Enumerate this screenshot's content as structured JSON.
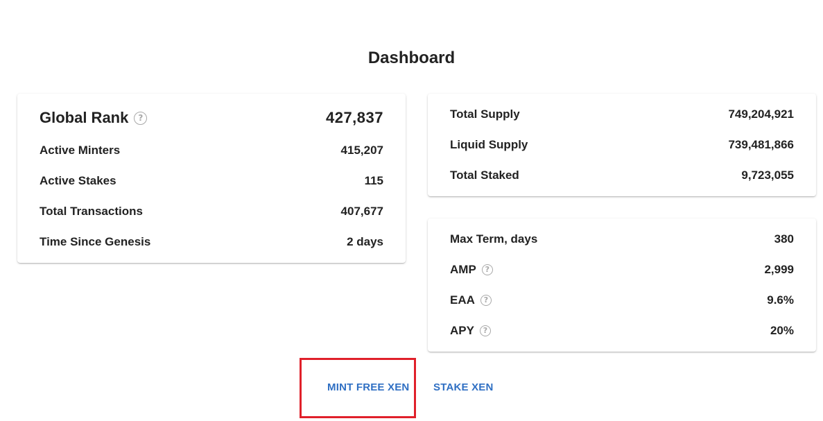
{
  "page": {
    "title": "Dashboard"
  },
  "stats_card": {
    "global_rank": {
      "label": "Global Rank",
      "value": "427,837",
      "icon": "help-circle-icon"
    },
    "rows": [
      {
        "label": "Active Minters",
        "value": "415,207"
      },
      {
        "label": "Active Stakes",
        "value": "115"
      },
      {
        "label": "Total Transactions",
        "value": "407,677"
      },
      {
        "label": "Time Since Genesis",
        "value": "2 days"
      }
    ]
  },
  "supply_card": {
    "rows": [
      {
        "label": "Total Supply",
        "value": "749,204,921"
      },
      {
        "label": "Liquid Supply",
        "value": "739,481,866"
      },
      {
        "label": "Total Staked",
        "value": "9,723,055"
      }
    ]
  },
  "params_card": {
    "rows": [
      {
        "label": "Max Term, days",
        "value": "380"
      },
      {
        "label": "AMP",
        "value": "2,999",
        "icon": "help-circle-icon"
      },
      {
        "label": "EAA",
        "value": "9.6%",
        "icon": "help-circle-icon"
      },
      {
        "label": "APY",
        "value": "20%",
        "icon": "help-circle-icon"
      }
    ]
  },
  "actions": {
    "mint_label": "MINT FREE XEN",
    "stake_label": "STAKE XEN"
  },
  "colors": {
    "link": "#2f6fc3",
    "highlight": "#e0202a",
    "text": "#222222",
    "icon": "#a8a8a8"
  }
}
